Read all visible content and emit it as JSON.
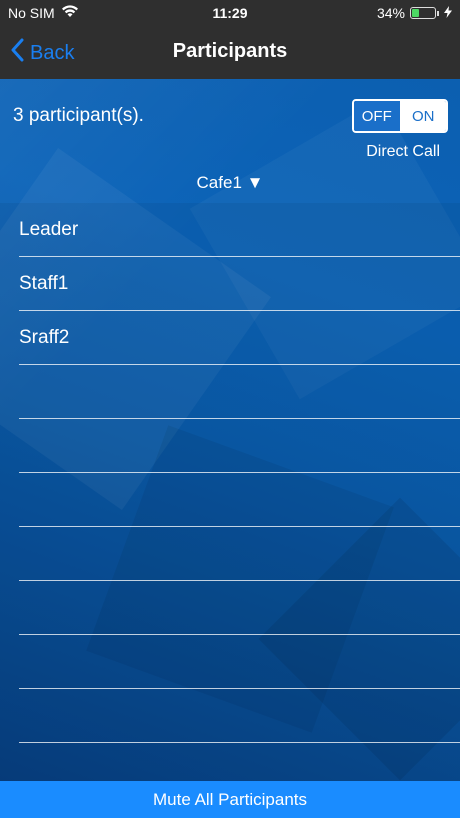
{
  "status": {
    "carrier": "No SIM",
    "time": "11:29",
    "battery": "34%",
    "battery_level": 0.34
  },
  "nav": {
    "back_label": "Back",
    "title": "Participants"
  },
  "header": {
    "count_text": "3  participant(s).",
    "toggle_off": "OFF",
    "toggle_on": "ON",
    "toggle_selected": "ON",
    "toggle_caption": "Direct Call",
    "group": "Cafe1 ▼"
  },
  "participants": [
    "Leader",
    "Staff1",
    "Sraff2",
    "",
    "",
    "",
    "",
    "",
    "",
    "",
    ""
  ],
  "footer": {
    "mute_all_label": "Mute All Participants"
  }
}
